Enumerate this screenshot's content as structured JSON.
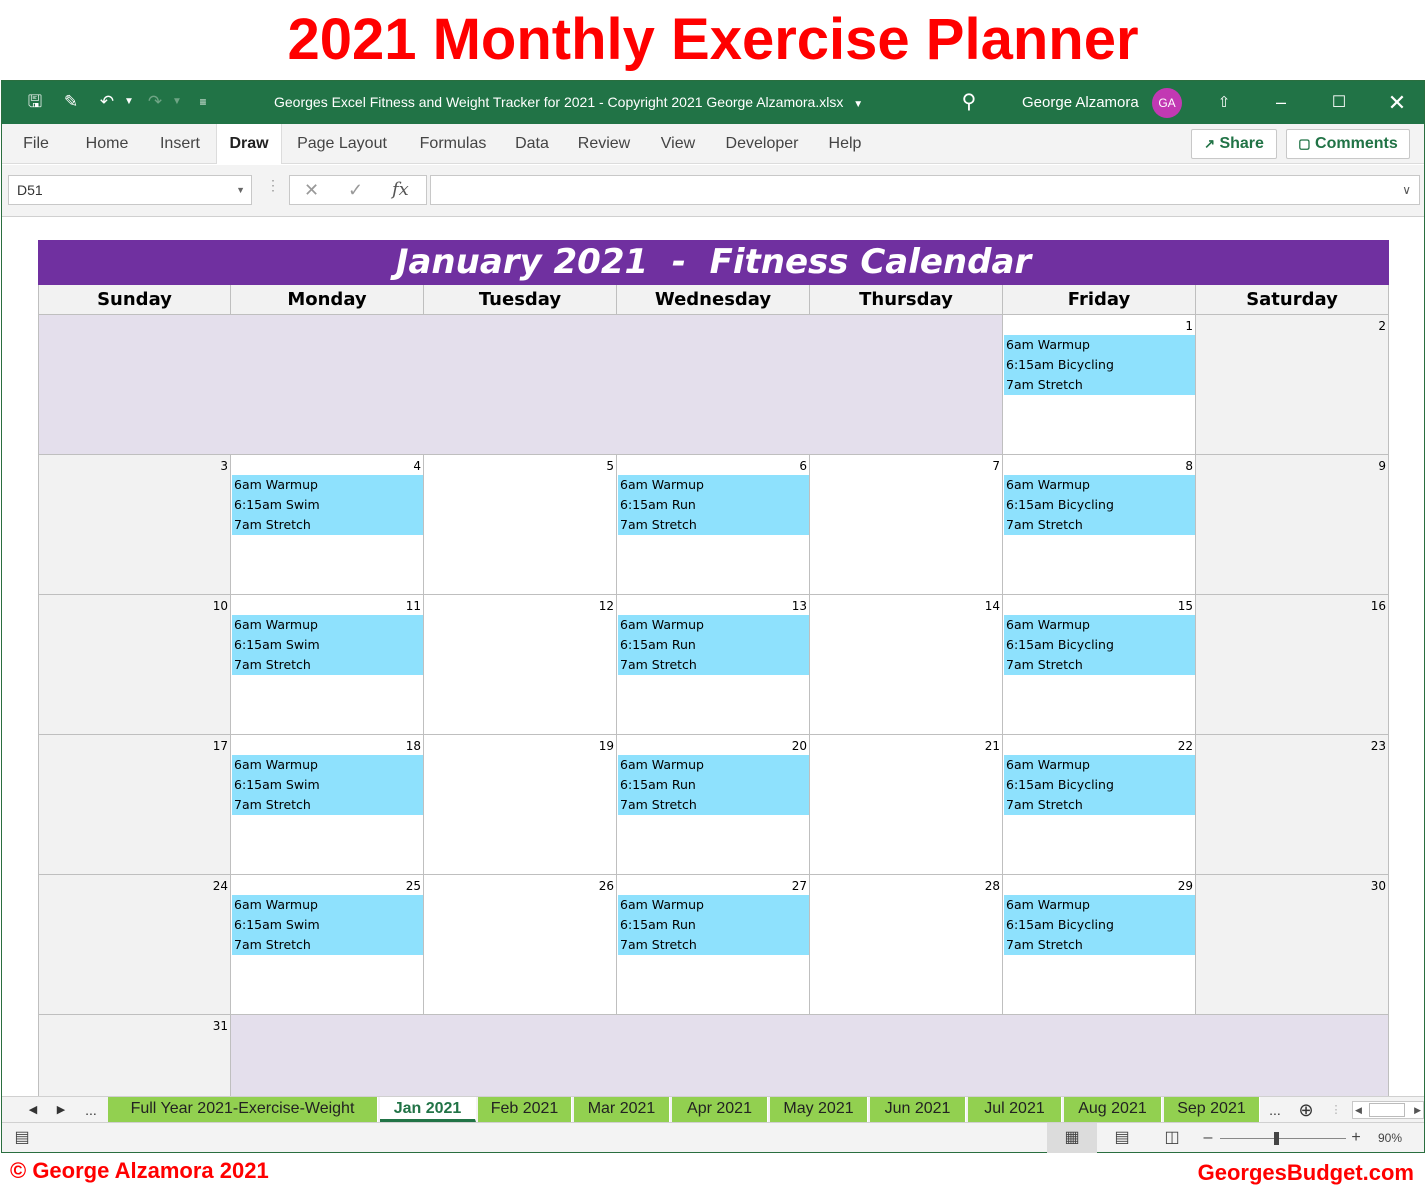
{
  "page_title": "2021 Monthly Exercise Planner",
  "window": {
    "doc_title": "Georges Excel Fitness and Weight Tracker for 2021 - Copyright 2021 George Alzamora.xlsx",
    "user_name": "George Alzamora",
    "user_initials": "GA",
    "avatar_color": "#c239b3",
    "theme_color": "#217346"
  },
  "ribbon": {
    "tabs": [
      "File",
      "Home",
      "Insert",
      "Draw",
      "Page Layout",
      "Formulas",
      "Data",
      "Review",
      "View",
      "Developer",
      "Help"
    ],
    "active_tab": "Draw",
    "share_label": "Share",
    "comments_label": "Comments"
  },
  "formula_bar": {
    "name_box": "D51",
    "formula": ""
  },
  "calendar": {
    "title": "January 2021  -  Fitness Calendar",
    "title_color": "#7030a0",
    "event_color": "#8ee1fd",
    "days": [
      "Sunday",
      "Monday",
      "Tuesday",
      "Wednesday",
      "Thursday",
      "Friday",
      "Saturday"
    ],
    "weeks": [
      [
        null,
        null,
        null,
        null,
        null,
        {
          "n": "1",
          "events": [
            "6am Warmup",
            "6:15am Bicycling",
            "7am Stretch"
          ]
        },
        {
          "n": "2",
          "events": []
        }
      ],
      [
        {
          "n": "3",
          "events": []
        },
        {
          "n": "4",
          "events": [
            "6am Warmup",
            "6:15am Swim",
            "7am Stretch"
          ]
        },
        {
          "n": "5",
          "events": []
        },
        {
          "n": "6",
          "events": [
            "6am Warmup",
            "6:15am Run",
            "7am Stretch"
          ]
        },
        {
          "n": "7",
          "events": []
        },
        {
          "n": "8",
          "events": [
            "6am Warmup",
            "6:15am Bicycling",
            "7am Stretch"
          ]
        },
        {
          "n": "9",
          "events": []
        }
      ],
      [
        {
          "n": "10",
          "events": []
        },
        {
          "n": "11",
          "events": [
            "6am Warmup",
            "6:15am Swim",
            "7am Stretch"
          ]
        },
        {
          "n": "12",
          "events": []
        },
        {
          "n": "13",
          "events": [
            "6am Warmup",
            "6:15am Run",
            "7am Stretch"
          ]
        },
        {
          "n": "14",
          "events": []
        },
        {
          "n": "15",
          "events": [
            "6am Warmup",
            "6:15am Bicycling",
            "7am Stretch"
          ]
        },
        {
          "n": "16",
          "events": []
        }
      ],
      [
        {
          "n": "17",
          "events": []
        },
        {
          "n": "18",
          "events": [
            "6am Warmup",
            "6:15am Swim",
            "7am Stretch"
          ]
        },
        {
          "n": "19",
          "events": []
        },
        {
          "n": "20",
          "events": [
            "6am Warmup",
            "6:15am Run",
            "7am Stretch"
          ]
        },
        {
          "n": "21",
          "events": []
        },
        {
          "n": "22",
          "events": [
            "6am Warmup",
            "6:15am Bicycling",
            "7am Stretch"
          ]
        },
        {
          "n": "23",
          "events": []
        }
      ],
      [
        {
          "n": "24",
          "events": []
        },
        {
          "n": "25",
          "events": [
            "6am Warmup",
            "6:15am Swim",
            "7am Stretch"
          ]
        },
        {
          "n": "26",
          "events": []
        },
        {
          "n": "27",
          "events": [
            "6am Warmup",
            "6:15am Run",
            "7am Stretch"
          ]
        },
        {
          "n": "28",
          "events": []
        },
        {
          "n": "29",
          "events": [
            "6am Warmup",
            "6:15am Bicycling",
            "7am Stretch"
          ]
        },
        {
          "n": "30",
          "events": []
        }
      ],
      [
        {
          "n": "31",
          "events": []
        },
        null,
        null,
        null,
        null,
        null,
        null
      ]
    ]
  },
  "sheet_tabs": {
    "ellipsis": "...",
    "tabs": [
      "Full Year 2021-Exercise-Weight",
      "Jan 2021",
      "Feb 2021",
      "Mar 2021",
      "Apr 2021",
      "May 2021",
      "Jun 2021",
      "Jul 2021",
      "Aug 2021",
      "Sep 2021"
    ],
    "active": "Jan 2021",
    "tab_color": "#92d050"
  },
  "status_bar": {
    "zoom": "90%"
  },
  "footer": {
    "left": "© George Alzamora 2021",
    "right": "GeorgesBudget.com"
  }
}
